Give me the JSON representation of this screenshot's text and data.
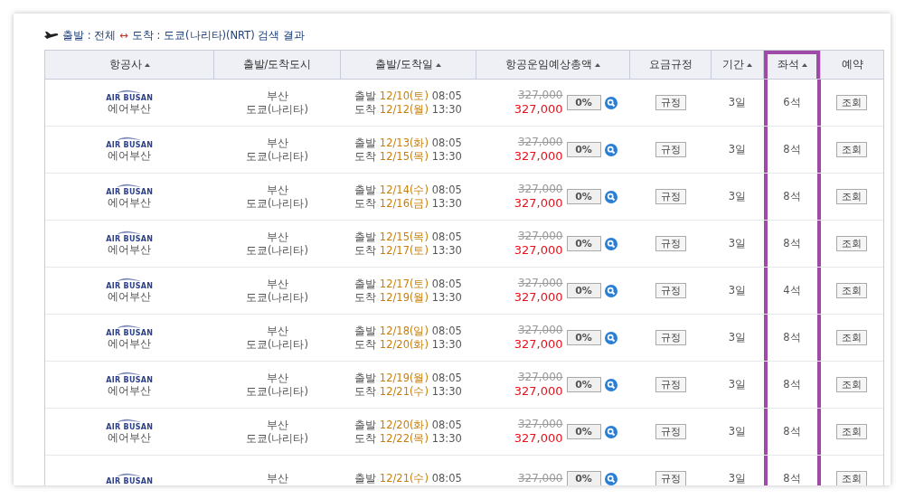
{
  "search_title": {
    "depart_label": "출발 : 전체",
    "arrow": "↔",
    "arrive_label": "도착 : 도쿄(나리타)(NRT) 검색 결과"
  },
  "table": {
    "columns": [
      {
        "label": "항공사",
        "sortable": true,
        "highlighted": false
      },
      {
        "label": "출발/도착도시",
        "sortable": false,
        "highlighted": false
      },
      {
        "label": "출발/도착일",
        "sortable": true,
        "highlighted": false
      },
      {
        "label": "항공운임예상총액",
        "sortable": true,
        "highlighted": false
      },
      {
        "label": "요금규정",
        "sortable": false,
        "highlighted": false
      },
      {
        "label": "기간",
        "sortable": true,
        "highlighted": false
      },
      {
        "label": "좌석",
        "sortable": true,
        "highlighted": true
      },
      {
        "label": "예약",
        "sortable": false,
        "highlighted": false
      }
    ],
    "rows": [
      {
        "logo_text": "AIR BUSAN",
        "airline": "에어부산",
        "from": "부산",
        "to": "도쿄(나리타)",
        "dep_label": "출발",
        "dep_date": "12/10(토)",
        "dep_time": "08:05",
        "arr_label": "도착",
        "arr_date": "12/12(월)",
        "arr_time": "13:30",
        "old_price": "327,000",
        "price": "327,000",
        "discount": "0%",
        "rule": "규정",
        "duration": "3일",
        "seats": "6석",
        "book": "조회"
      },
      {
        "logo_text": "AIR BUSAN",
        "airline": "에어부산",
        "from": "부산",
        "to": "도쿄(나리타)",
        "dep_label": "출발",
        "dep_date": "12/13(화)",
        "dep_time": "08:05",
        "arr_label": "도착",
        "arr_date": "12/15(목)",
        "arr_time": "13:30",
        "old_price": "327,000",
        "price": "327,000",
        "discount": "0%",
        "rule": "규정",
        "duration": "3일",
        "seats": "8석",
        "book": "조회"
      },
      {
        "logo_text": "AIR BUSAN",
        "airline": "에어부산",
        "from": "부산",
        "to": "도쿄(나리타)",
        "dep_label": "출발",
        "dep_date": "12/14(수)",
        "dep_time": "08:05",
        "arr_label": "도착",
        "arr_date": "12/16(금)",
        "arr_time": "13:30",
        "old_price": "327,000",
        "price": "327,000",
        "discount": "0%",
        "rule": "규정",
        "duration": "3일",
        "seats": "8석",
        "book": "조회"
      },
      {
        "logo_text": "AIR BUSAN",
        "airline": "에어부산",
        "from": "부산",
        "to": "도쿄(나리타)",
        "dep_label": "출발",
        "dep_date": "12/15(목)",
        "dep_time": "08:05",
        "arr_label": "도착",
        "arr_date": "12/17(토)",
        "arr_time": "13:30",
        "old_price": "327,000",
        "price": "327,000",
        "discount": "0%",
        "rule": "규정",
        "duration": "3일",
        "seats": "8석",
        "book": "조회"
      },
      {
        "logo_text": "AIR BUSAN",
        "airline": "에어부산",
        "from": "부산",
        "to": "도쿄(나리타)",
        "dep_label": "출발",
        "dep_date": "12/17(토)",
        "dep_time": "08:05",
        "arr_label": "도착",
        "arr_date": "12/19(월)",
        "arr_time": "13:30",
        "old_price": "327,000",
        "price": "327,000",
        "discount": "0%",
        "rule": "규정",
        "duration": "3일",
        "seats": "4석",
        "book": "조회"
      },
      {
        "logo_text": "AIR BUSAN",
        "airline": "에어부산",
        "from": "부산",
        "to": "도쿄(나리타)",
        "dep_label": "출발",
        "dep_date": "12/18(일)",
        "dep_time": "08:05",
        "arr_label": "도착",
        "arr_date": "12/20(화)",
        "arr_time": "13:30",
        "old_price": "327,000",
        "price": "327,000",
        "discount": "0%",
        "rule": "규정",
        "duration": "3일",
        "seats": "8석",
        "book": "조회"
      },
      {
        "logo_text": "AIR BUSAN",
        "airline": "에어부산",
        "from": "부산",
        "to": "도쿄(나리타)",
        "dep_label": "출발",
        "dep_date": "12/19(월)",
        "dep_time": "08:05",
        "arr_label": "도착",
        "arr_date": "12/21(수)",
        "arr_time": "13:30",
        "old_price": "327,000",
        "price": "327,000",
        "discount": "0%",
        "rule": "규정",
        "duration": "3일",
        "seats": "8석",
        "book": "조회"
      },
      {
        "logo_text": "AIR BUSAN",
        "airline": "에어부산",
        "from": "부산",
        "to": "도쿄(나리타)",
        "dep_label": "출발",
        "dep_date": "12/20(화)",
        "dep_time": "08:05",
        "arr_label": "도착",
        "arr_date": "12/22(목)",
        "arr_time": "13:30",
        "old_price": "327,000",
        "price": "327,000",
        "discount": "0%",
        "rule": "규정",
        "duration": "3일",
        "seats": "8석",
        "book": "조회"
      },
      {
        "logo_text": "AIR BUSAN",
        "from": "부산",
        "dep_label": "출발",
        "dep_date": "12/21(수)",
        "dep_time": "08:05",
        "old_price": "327,000",
        "discount": "0%",
        "rule": "규정",
        "duration": "3일",
        "seats": "8석",
        "book": "조회"
      }
    ]
  }
}
